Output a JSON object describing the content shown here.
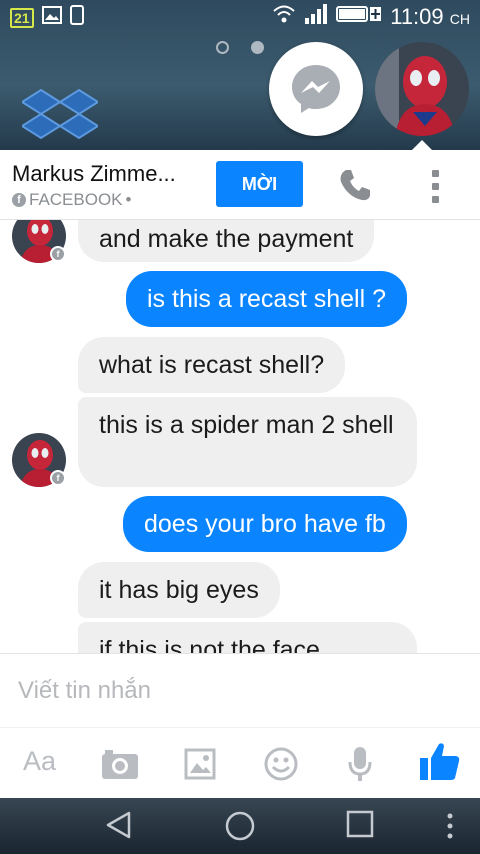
{
  "status_bar": {
    "badge": "21",
    "time": "11:09",
    "time_suffix": "CH"
  },
  "header": {
    "contact_name": "Markus Zimme...",
    "source": "FACEBOOK",
    "source_suffix": "•",
    "invite_label": "MỜI"
  },
  "messages": [
    {
      "direction": "in",
      "text": "and make the payment"
    },
    {
      "direction": "out",
      "text": "is this a recast shell ?"
    },
    {
      "direction": "in",
      "text": "what is recast shell?"
    },
    {
      "direction": "in",
      "text": "this is a spider man 2 shell"
    },
    {
      "direction": "out",
      "text": "does your bro have fb"
    },
    {
      "direction": "in",
      "text": "it has big eyes"
    },
    {
      "direction": "in",
      "text": "if this is not the face"
    }
  ],
  "composer": {
    "placeholder": "Viết tin nhắn",
    "aa_label": "Aa"
  },
  "colors": {
    "accent": "#0a84ff",
    "incoming_bubble": "#efeff0",
    "icon_gray": "#b9bdc2"
  },
  "icons": {
    "status": [
      "gallery-icon",
      "phone-icon",
      "wifi-icon",
      "signal-icon",
      "battery-icon"
    ],
    "toolbar": [
      "camera-icon",
      "image-icon",
      "emoji-icon",
      "microphone-icon",
      "thumbs-up-icon"
    ],
    "nav": [
      "back-icon",
      "home-icon",
      "recents-icon",
      "overflow-icon"
    ]
  }
}
